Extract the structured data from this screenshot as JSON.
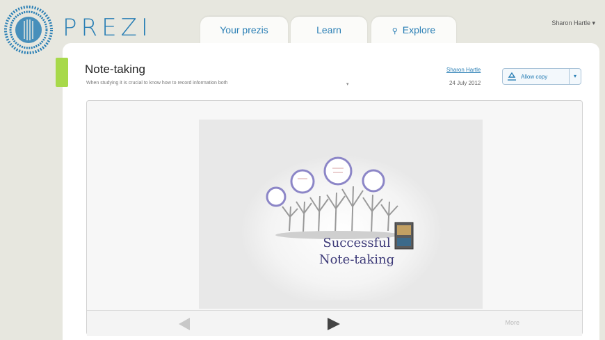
{
  "header": {
    "brand": "PREZI",
    "tabs": [
      {
        "label": "Your prezis"
      },
      {
        "label": "Learn"
      },
      {
        "label": "Explore"
      }
    ],
    "user": "Sharon Hartle",
    "user_caret": "▾"
  },
  "prezi": {
    "title": "Note-taking",
    "description": "When studying it is crucial to know how to record information both",
    "description_caret": "▾",
    "author": "Sharon Hartle",
    "date": "24 July 2012",
    "allow_copy_label": "Allow copy",
    "allow_copy_caret": "▾"
  },
  "slide": {
    "line1": "Successful",
    "line2": "Note-taking"
  },
  "viewer": {
    "more_label": "More"
  },
  "colors": {
    "brand_blue": "#2a7fb5",
    "accent_green": "#a7d94a",
    "slide_text": "#3d3a78"
  },
  "icons": [
    "prezi-logo-icon",
    "search-icon",
    "recycle-icon",
    "chevron-down-icon",
    "previous-arrow-icon",
    "next-arrow-icon"
  ]
}
